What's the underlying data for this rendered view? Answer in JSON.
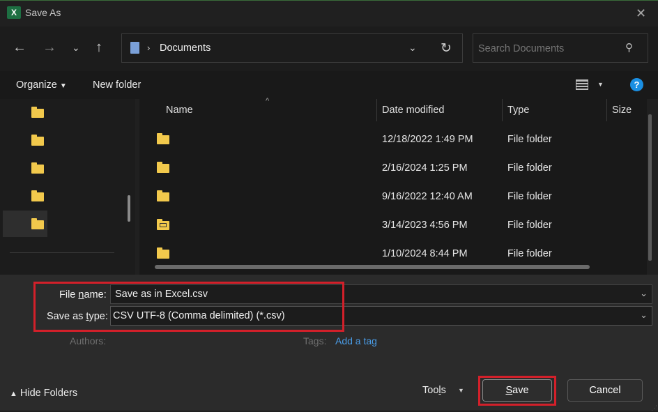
{
  "window": {
    "title": "Save As",
    "app_icon": "excel-icon",
    "app_icon_letter": "X"
  },
  "address_bar": {
    "current_folder": "Documents"
  },
  "search": {
    "placeholder": "Search Documents"
  },
  "commands": {
    "organize": "Organize",
    "new_folder": "New folder",
    "help": "?"
  },
  "columns": {
    "name": "Name",
    "date": "Date modified",
    "type": "Type",
    "size": "Size"
  },
  "files": [
    {
      "name": "",
      "date": "12/18/2022 1:49 PM",
      "type": "File folder",
      "icon": "folder-icon"
    },
    {
      "name": "",
      "date": "2/16/2024 1:25 PM",
      "type": "File folder",
      "icon": "folder-icon"
    },
    {
      "name": "",
      "date": "9/16/2022 12:40 AM",
      "type": "File folder",
      "icon": "folder-icon"
    },
    {
      "name": "",
      "date": "3/14/2023 4:56 PM",
      "type": "File folder",
      "icon": "shared-folder-icon"
    },
    {
      "name": "",
      "date": "1/10/2024 8:44 PM",
      "type": "File folder",
      "icon": "folder-icon"
    }
  ],
  "form": {
    "file_name_label_pre": "File ",
    "file_name_label_ul": "n",
    "file_name_label_post": "ame:",
    "file_name_value": "Save as in Excel.csv",
    "save_type_label_pre": "Save as ",
    "save_type_label_ul": "t",
    "save_type_label_post": "ype:",
    "save_type_value": "CSV UTF-8 (Comma delimited) (*.csv)",
    "authors_label": "Authors:",
    "tags_label": "Tags:",
    "tags_link": "Add a tag"
  },
  "footer": {
    "hide_folders": "Hide Folders",
    "tools_pre": "Too",
    "tools_ul": "l",
    "tools_post": "s",
    "save_ul": "S",
    "save_rest": "ave",
    "cancel": "Cancel"
  },
  "colors": {
    "highlight_border": "#d3202a",
    "link": "#4a9de8",
    "help_blue": "#1a8fe3",
    "folder": "#f2c94c"
  }
}
